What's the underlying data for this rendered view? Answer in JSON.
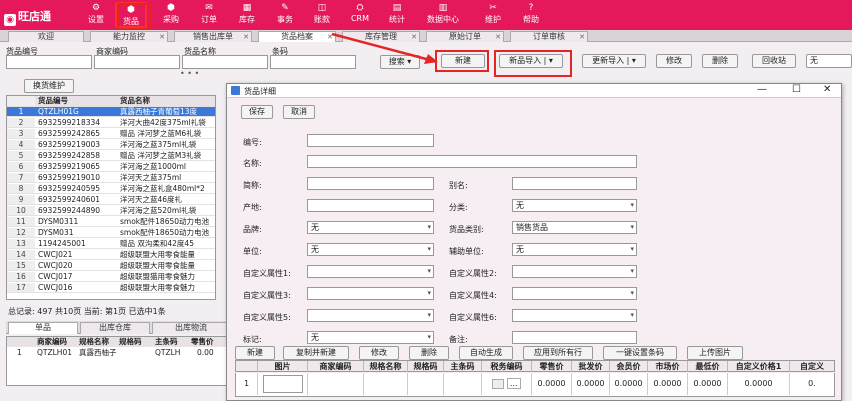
{
  "app": {
    "logo": "旺店通"
  },
  "nav": [
    {
      "label": "设置",
      "icon": "⚙"
    },
    {
      "label": "货品",
      "icon": "⬢"
    },
    {
      "label": "采购",
      "icon": "⬢"
    },
    {
      "label": "订单",
      "icon": "✉"
    },
    {
      "label": "库存",
      "icon": "▦"
    },
    {
      "label": "事务",
      "icon": "✎"
    },
    {
      "label": "账款",
      "icon": "◫"
    },
    {
      "label": "CRM",
      "icon": "⛭"
    },
    {
      "label": "统计",
      "icon": "▤"
    },
    {
      "label": "数据中心",
      "icon": "▥"
    },
    {
      "label": "维护",
      "icon": "✂"
    },
    {
      "label": "帮助",
      "icon": "?"
    }
  ],
  "tabs": [
    "欢迎",
    "能力监控",
    "销售出库单",
    "货品档案",
    "库存管理",
    "原始订单",
    "订单审核"
  ],
  "filter": {
    "code_label": "货品编号",
    "merchant_label": "商家编码",
    "name_label": "货品名称",
    "barcode_label": "条码",
    "search_btn": "搜索",
    "new_btn": "新建",
    "import_new_btn": "新品导入",
    "update_import_btn": "更新导入",
    "edit_btn": "修改",
    "delete_btn": "删除",
    "recycle_btn": "回收站",
    "select_value": "无",
    "maintain_btn": "换货维护"
  },
  "list": {
    "headers": [
      "货品编号",
      "货品名称"
    ],
    "rows": [
      {
        "n": "1",
        "code": "QTZLH01G",
        "name": "真露西柚子青葡萄13度"
      },
      {
        "n": "2",
        "code": "6932599218334",
        "name": "洋河大曲42度375ml礼袋"
      },
      {
        "n": "3",
        "code": "6932599242865",
        "name": "赠品 洋河梦之蓝M6礼袋"
      },
      {
        "n": "4",
        "code": "6932599219003",
        "name": "洋河海之蓝375ml礼袋"
      },
      {
        "n": "5",
        "code": "6932599242858",
        "name": "赠品 洋河梦之蓝M3礼袋"
      },
      {
        "n": "6",
        "code": "6932599219065",
        "name": "洋河海之蓝1000ml"
      },
      {
        "n": "7",
        "code": "6932599219010",
        "name": "洋河天之蓝375ml"
      },
      {
        "n": "8",
        "code": "6932599240595",
        "name": "洋河海之蓝礼盒480ml*2"
      },
      {
        "n": "9",
        "code": "6932599240601",
        "name": "洋河天之蓝46度礼"
      },
      {
        "n": "10",
        "code": "6932599244890",
        "name": "洋河海之蓝520ml礼袋"
      },
      {
        "n": "11",
        "code": "DYSM0311",
        "name": "smok配件18650动力电池"
      },
      {
        "n": "12",
        "code": "DYSM031",
        "name": "smok配件18650动力电池"
      },
      {
        "n": "13",
        "code": "1194245001",
        "name": "赠品 双沟柔和42度45"
      },
      {
        "n": "14",
        "code": "CWCJ021",
        "name": "超级联盟大用零食能量"
      },
      {
        "n": "15",
        "code": "CWCJ020",
        "name": "超级联盟大用零食能量"
      },
      {
        "n": "16",
        "code": "CWCJ017",
        "name": "超级联盟猫用零食魅力"
      },
      {
        "n": "17",
        "code": "CWCJ016",
        "name": "超级联盟大用零食魅力"
      }
    ],
    "summary": "总记录: 497 共10页 当前: 第1页 已选中1条"
  },
  "bottom": {
    "tabs": [
      "单品",
      "出库仓库",
      "出库物流"
    ],
    "headers": [
      "商家编码",
      "规格名称",
      "规格码",
      "主条码",
      "零售价"
    ],
    "row": {
      "n": "1",
      "code": "QTZLH01",
      "name": "真露西柚子",
      "spec": "",
      "barcode": "QTZLH",
      "price": "0.00"
    }
  },
  "modal": {
    "title": "货品详细",
    "save_btn": "保存",
    "cancel_btn": "取消",
    "fields": {
      "code": "编号:",
      "name": "名称:",
      "short": "简称:",
      "alias": "别名:",
      "origin": "产地:",
      "category": "分类:",
      "brand": "品牌:",
      "goods_type": "货品类别:",
      "unit": "单位:",
      "aux_unit": "辅助单位:",
      "c1": "自定义属性1:",
      "c2": "自定义属性2:",
      "c3": "自定义属性3:",
      "c4": "自定义属性4:",
      "c5": "自定义属性5:",
      "c6": "自定义属性6:",
      "mark": "标记:",
      "remark": "备注:"
    },
    "values": {
      "category": "无",
      "brand": "无",
      "goods_type": "销售货品",
      "unit": "无",
      "aux_unit": "无",
      "mark": "无"
    },
    "actions": [
      "新建",
      "复制并新建",
      "修改",
      "删除",
      "自动生成",
      "应用到所有行",
      "一键设置条码",
      "上传图片"
    ],
    "grid_headers": [
      "图片",
      "商家编码",
      "规格名称",
      "规格码",
      "主条码",
      "税务编码",
      "零售价",
      "批发价",
      "会员价",
      "市场价",
      "最低价",
      "自定义价格1",
      "自定义"
    ],
    "grid_row": {
      "n": "1",
      "tax_btn": "...",
      "retail": "0.0000",
      "wholesale": "0.0000",
      "member": "0.0000",
      "market": "0.0000",
      "min": "0.0000",
      "custom1": "0.0000",
      "custom2": "0."
    }
  }
}
